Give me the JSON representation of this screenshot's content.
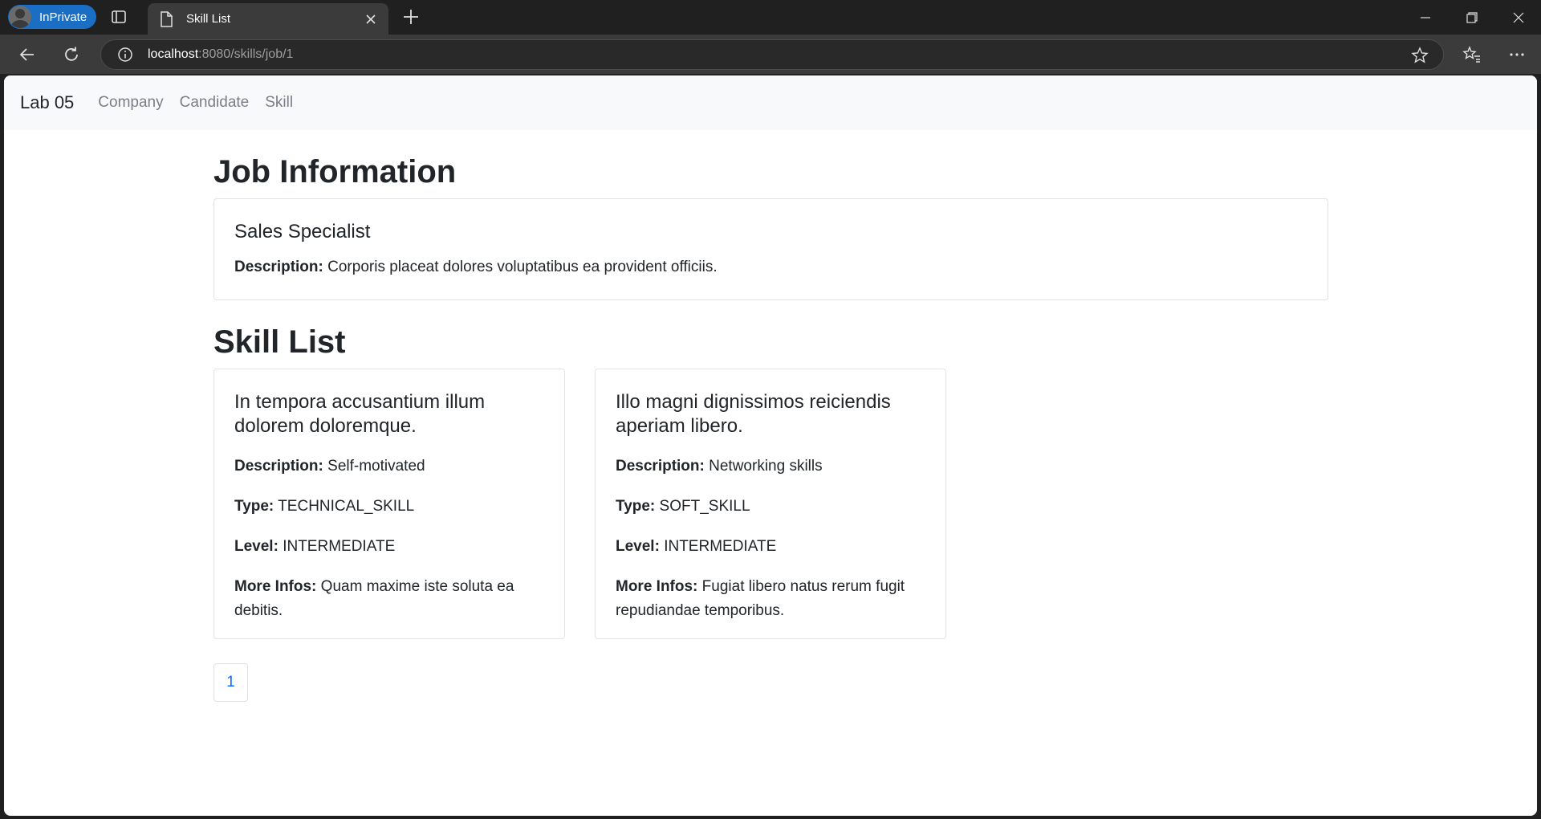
{
  "browser": {
    "profile_label": "InPrivate",
    "tab_title": "Skill List",
    "url_host": "localhost",
    "url_rest": ":8080/skills/job/1"
  },
  "navbar": {
    "brand": "Lab 05",
    "links": [
      "Company",
      "Candidate",
      "Skill"
    ]
  },
  "job_section": {
    "heading": "Job Information",
    "job": {
      "name": "Sales Specialist",
      "description_label": "Description:",
      "description": "Corporis placeat dolores voluptatibus ea provident officiis."
    }
  },
  "skill_section": {
    "heading": "Skill List",
    "skills": [
      {
        "name": "In tempora accusantium illum dolorem doloremque.",
        "description_label": "Description:",
        "description": "Self-motivated",
        "type_label": "Type:",
        "type": "TECHNICAL_SKILL",
        "level_label": "Level:",
        "level": "INTERMEDIATE",
        "more_label": "More Infos:",
        "more": "Quam maxime iste soluta ea debitis."
      },
      {
        "name": "Illo magni dignissimos reiciendis aperiam libero.",
        "description_label": "Description:",
        "description": "Networking skills",
        "type_label": "Type:",
        "type": "SOFT_SKILL",
        "level_label": "Level:",
        "level": "INTERMEDIATE",
        "more_label": "More Infos:",
        "more": "Fugiat libero natus rerum fugit repudiandae temporibus."
      }
    ]
  },
  "pagination": {
    "pages": [
      "1"
    ]
  },
  "colors": {
    "link_blue": "#0d6efd",
    "inprivate_blue": "#1a6fc4"
  }
}
